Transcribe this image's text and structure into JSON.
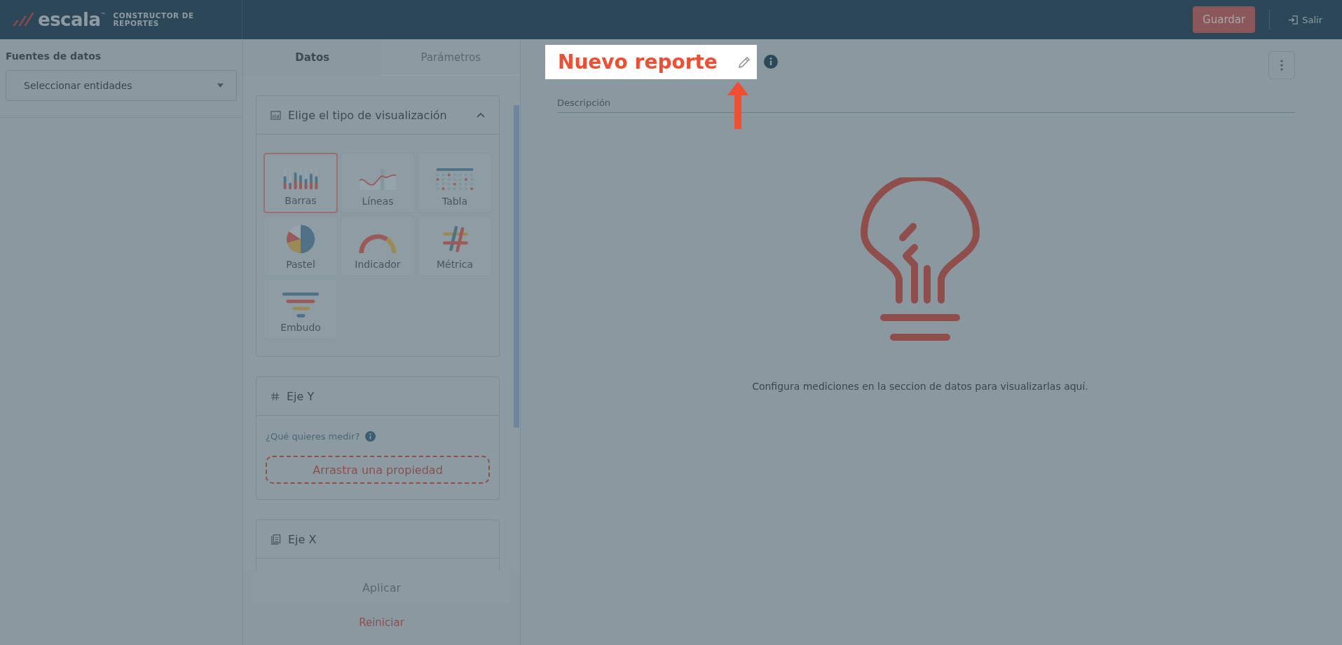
{
  "header": {
    "brand": "escala",
    "trademark": "™",
    "product": "CONSTRUCTOR DE REPORTES",
    "save_button": "Guardar",
    "exit_button": "Salir"
  },
  "sources": {
    "title": "Fuentes de datos",
    "select": {
      "value": "Seleccionar entidades"
    }
  },
  "tabs": [
    {
      "label": "Datos",
      "selected": true
    },
    {
      "label": "Parámetros",
      "selected": false
    }
  ],
  "visualization": {
    "title": "Elige el tipo de visualización",
    "expanded": true,
    "types": [
      {
        "kind": "bars",
        "label": "Barras",
        "selected": true
      },
      {
        "kind": "lines",
        "label": "Líneas",
        "selected": false
      },
      {
        "kind": "table",
        "label": "Tabla",
        "selected": false
      },
      {
        "kind": "pie",
        "label": "Pastel",
        "selected": false
      },
      {
        "kind": "gauge",
        "label": "Indicador",
        "selected": false
      },
      {
        "kind": "metric",
        "label": "Métrica",
        "selected": false
      },
      {
        "kind": "funnel",
        "label": "Embudo",
        "selected": false
      }
    ]
  },
  "y_axis": {
    "title": "Eje Y",
    "question": "¿Qué quieres medir?",
    "drop_zone": "Arrastra una propiedad"
  },
  "x_axis": {
    "title": "Eje X"
  },
  "actions": {
    "apply": "Aplicar",
    "reset": "Reiniciar"
  },
  "report": {
    "title": "Nuevo reporte",
    "description_placeholder": "Descripción",
    "empty_message": "Configura mediciones en la seccion de datos para visualizarlas aquí."
  }
}
